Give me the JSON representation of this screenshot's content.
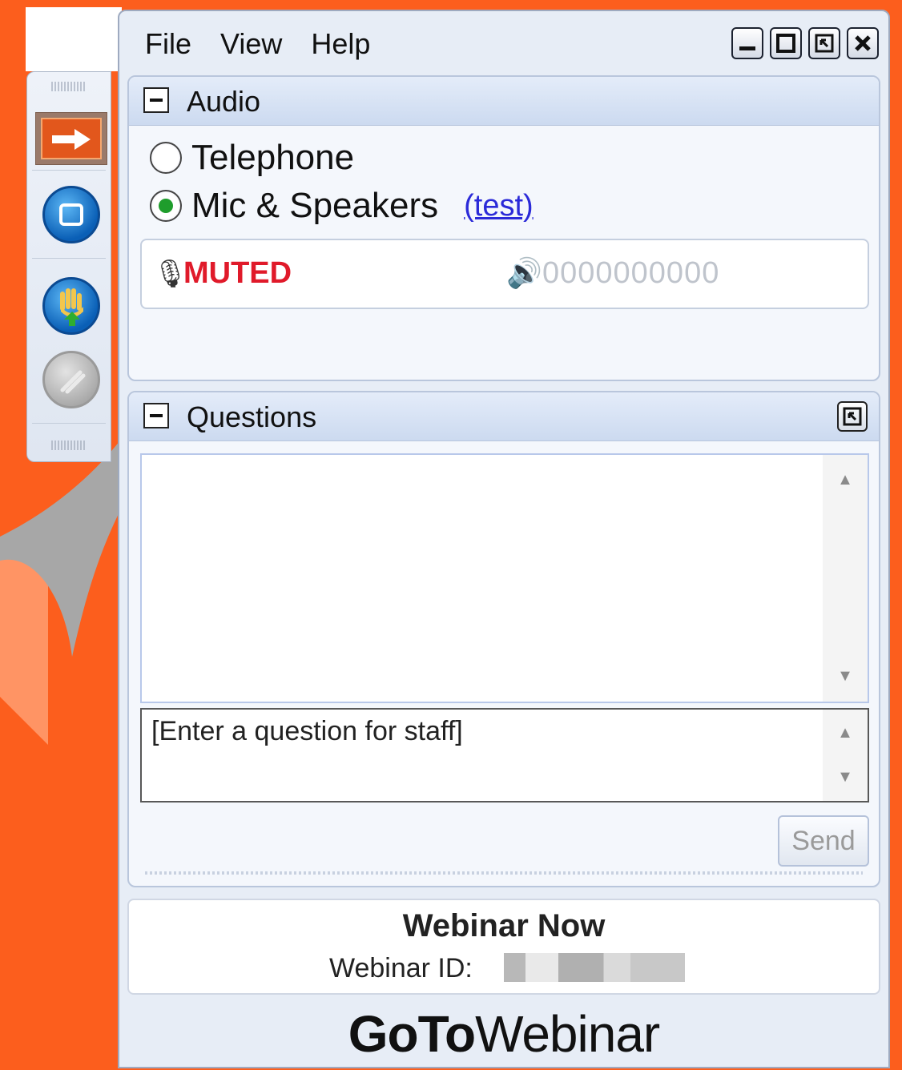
{
  "menu": {
    "items": [
      "File",
      "View",
      "Help"
    ]
  },
  "audio": {
    "title": "Audio",
    "options": [
      {
        "label": "Telephone",
        "selected": false
      },
      {
        "label": "Mic & Speakers",
        "selected": true
      }
    ],
    "test_link": "(test)",
    "mute_status": "MUTED",
    "level_readout": "0000000000"
  },
  "questions": {
    "title": "Questions",
    "input_placeholder": "[Enter a question for staff]",
    "send_label": "Send"
  },
  "webinar": {
    "name": "Webinar Now",
    "id_label": "Webinar ID:"
  },
  "brand": {
    "bold": "GoTo",
    "regular": "Webinar"
  },
  "colors": {
    "background": "#fc5e1d",
    "muted": "#e01a2a",
    "link": "#2b2ad8",
    "radio_selected": "#1f9d2c"
  }
}
